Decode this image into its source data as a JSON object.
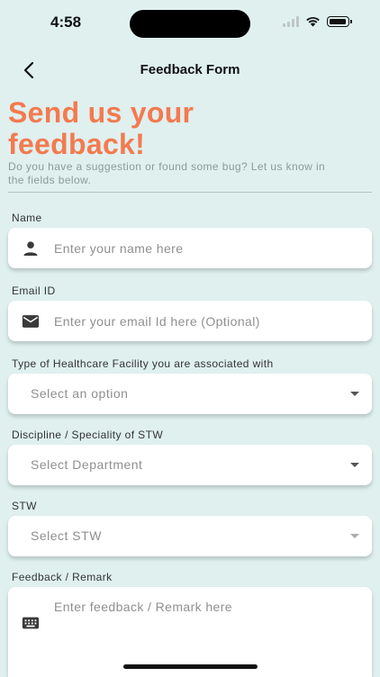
{
  "status_bar": {
    "time": "4:58"
  },
  "nav": {
    "title": "Feedback Form"
  },
  "hero": {
    "title": "Send us your feedback!",
    "subtitle": "Do you have a suggestion or found some bug? Let us know in the fields below."
  },
  "form": {
    "name": {
      "label": "Name",
      "placeholder": "Enter your name here",
      "icon": "person-icon"
    },
    "email": {
      "label": "Email ID",
      "placeholder": "Enter your email Id here (Optional)",
      "icon": "mail-icon"
    },
    "facility": {
      "label": "Type of Healthcare Facility you are associated with",
      "value": "Select an option"
    },
    "discipline": {
      "label": "Discipline / Speciality of STW",
      "value": "Select Department"
    },
    "stw": {
      "label": "STW",
      "value": "Select STW"
    },
    "feedback": {
      "label": "Feedback / Remark",
      "placeholder": "Enter feedback / Remark here",
      "icon": "keyboard-icon"
    }
  },
  "colors": {
    "background": "#dff0ef",
    "accent": "#f47a4f",
    "field_bg": "#ffffff"
  }
}
